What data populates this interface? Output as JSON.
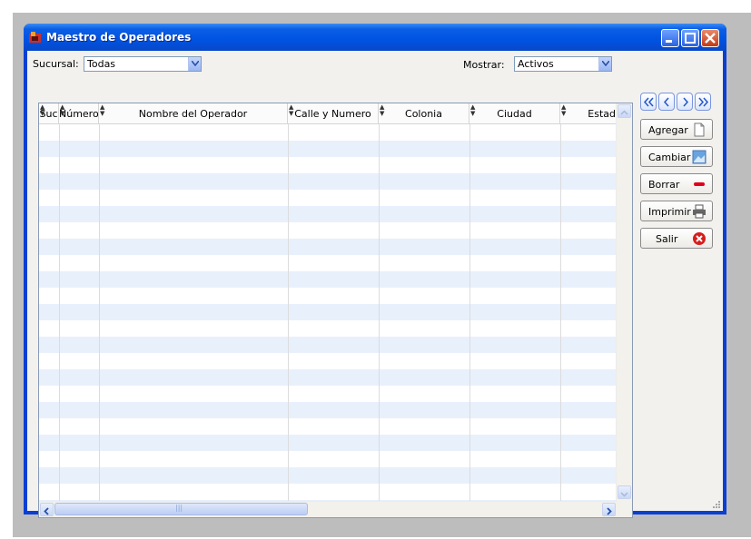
{
  "window": {
    "title": "Maestro de Operadores"
  },
  "filters": {
    "sucursal_label": "Sucursal:",
    "sucursal_value": "Todas",
    "mostrar_label": "Mostrar:",
    "mostrar_value": "Activos"
  },
  "grid": {
    "columns": [
      {
        "label": "Suc"
      },
      {
        "label": "Número"
      },
      {
        "label": "Nombre del Operador"
      },
      {
        "label": "Calle y Numero"
      },
      {
        "label": "Colonia"
      },
      {
        "label": "Ciudad"
      },
      {
        "label": "Estad"
      }
    ],
    "hscroll_grip": "|||"
  },
  "actions": {
    "agregar": "Agregar",
    "cambiar": "Cambiar",
    "borrar": "Borrar",
    "imprimir": "Imprimir",
    "salir": "Salir"
  },
  "icons": {
    "app": "app-icon",
    "nav_first": "double-chevron-left-icon",
    "nav_prev": "chevron-left-icon",
    "nav_next": "chevron-right-icon",
    "nav_last": "double-chevron-right-icon"
  },
  "colors": {
    "titlebar": "#0053e1",
    "row_alt": "#e8f0fc",
    "close_button": "#c43a17"
  }
}
